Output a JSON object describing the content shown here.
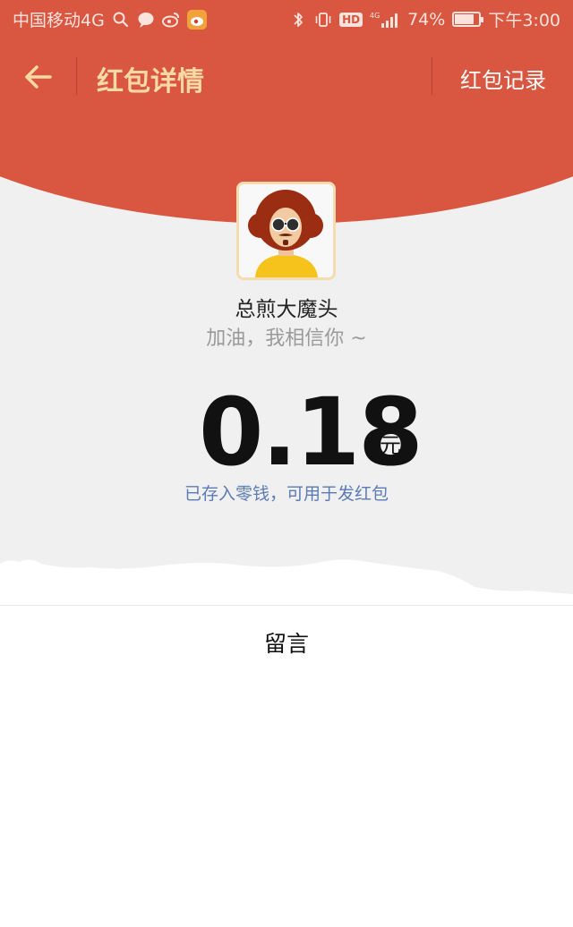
{
  "status_bar": {
    "carrier": "中国移动4G",
    "battery_percent": "74%",
    "battery_level": 0.74,
    "network": "4G",
    "hd_label": "HD",
    "time": "下午3:00",
    "icons": [
      "search-icon",
      "chat-bubble-icon",
      "weibo-icon",
      "weibo-app-icon",
      "bluetooth-icon",
      "vibrate-icon",
      "signal-icon",
      "battery-icon"
    ]
  },
  "header": {
    "title": "红包详情",
    "record_link": "红包记录",
    "back_icon": "back-arrow-icon",
    "accent_color": "#d95640",
    "title_color": "#f9d9a4"
  },
  "sender": {
    "name": "总煎大魔头",
    "wish": "加油，我相信你 ~"
  },
  "amount": {
    "value": "0.18",
    "unit": "元",
    "note": "已存入零钱，可用于发红包"
  },
  "footer": {
    "message_label": "留言"
  }
}
